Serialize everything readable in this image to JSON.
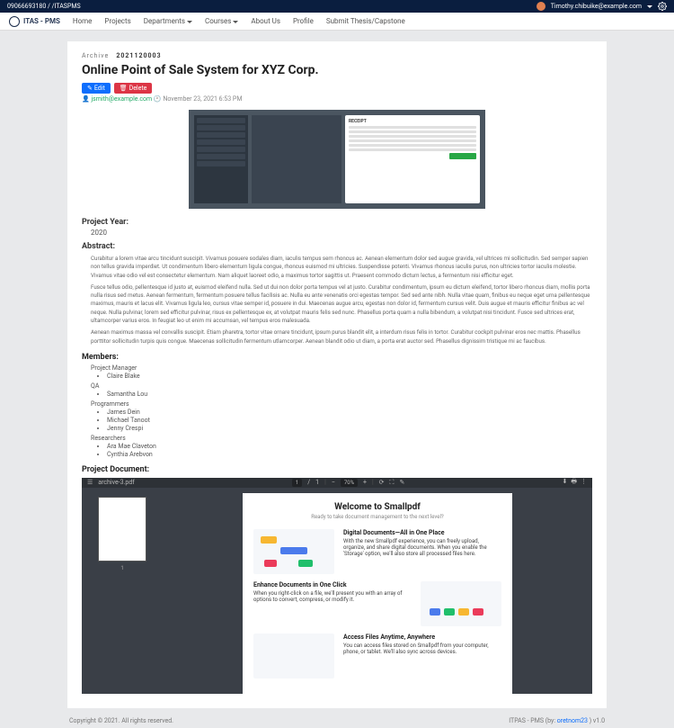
{
  "topstrip": {
    "left": "09066693180 / /ITASPMS",
    "user": "Timothy.chibuike@example.com"
  },
  "nav": {
    "brand": "ITAS - PMS",
    "items": [
      "Home",
      "Projects",
      "Departments",
      "Courses",
      "About Us",
      "Profile",
      "Submit Thesis/Capstone"
    ]
  },
  "crumb": {
    "a": "Archive",
    "b": "2021120003"
  },
  "title": "Online Point of Sale System for XYZ Corp.",
  "btns": {
    "edit": "Edit",
    "del": "Delete"
  },
  "meta": {
    "author": "jsmith@example.com",
    "date": "November 23, 2021 6:53 PM"
  },
  "year": {
    "label": "Project Year:",
    "value": "2020"
  },
  "abs": {
    "label": "Abstract:",
    "p1": "Curabitur a lorem vitae arcu tincidunt suscipit. Vivamus posuere sodales diam, iaculis tempus sem rhoncus ac. Aenean elementum dolor sed augue gravida, vel ultrices mi sollicitudin. Sed semper sapien non tellus gravida imperdiet. Ut condimentum libero elementum ligula congue, rhoncus euismod mi ultricies. Suspendisse potenti. Vivamus rhoncus iaculis purus, non ultricies tortor iaculis molestie. Vivamus vitae odio vel est consectetur elementum. Nam aliquet laoreet odio, a maximus tortor sagittis ut. Praesent commodo dictum lectus, a fermentum nisi efficitur eget.",
    "p2": "Fusce tellus odio, pellentesque id justo at, euismod eleifend nulla. Sed ut dui non dolor porta tempus vel at justo. Curabitur condimentum, ipsum eu dictum eleifend, tortor libero rhoncus diam, mollis porta nulla risus sed metus. Aenean fermentum, fermentum posuere tellus facilisis ac. Nulla eu ante venenatis orci egestas tempor. Sed sed ante nibh. Nulla vitae quam, finibus eu neque eget urna pellentesque maximus, mauris et lacus elit. Vivamus ligula leo, cursus vitae semper id, posuere in dui. Maecenas augue arcu, egestas non dolor id, fermentum cursus velit. Duis augue et mauris efficitur finibus ac vel neque. Nulla pulvinar, lorem sed efficitur pulvinar, risus ex pellentesque ex, at volutpat mauris felis sed nunc. Phasellus porta quam a nulla bibendum, a volutpat nisi tincidunt. Fusce sed ultrices erat, ultamcorper varius eros. In feugiat leo ut enim mi accumsan, vel tempus eros malesuada.",
    "p3": "Aenean maximus massa vel convallis suscipit. Etiam pharetra, tortor vitae ornare tincidunt, ipsum purus blandit elit, a interdum risus felis in tortor. Curabitur cockpit pulvinar eros nec mattis. Phasellus porttitor sollicitudin turpis quis congue. Maecenas sollicitudin fermentum utlamcorper. Aenean blandit odio ut diam, a porta erat auctor sed. Phasellus dignissim tristique mi ac faucibus."
  },
  "mem": {
    "label": "Members:",
    "roles": [
      {
        "role": "Project Manager",
        "list": [
          "Claire Blake"
        ]
      },
      {
        "role": "QA",
        "list": [
          "Samantha Lou"
        ]
      },
      {
        "role": "Programmers",
        "list": [
          "James Dein",
          "Michael Tanoot",
          "Jenny Crespi"
        ]
      },
      {
        "role": "Researchers",
        "list": [
          "Ara Mae Claveton",
          "Cynthia Arebvon"
        ]
      }
    ]
  },
  "doc": {
    "label": "Project Document:"
  },
  "pdf": {
    "file": "archive-3.pdf",
    "page": "1",
    "of": "1",
    "zoom": "70%",
    "thumb_num": "1",
    "h": "Welcome to Smallpdf",
    "sub": "Ready to take document management to the next level?",
    "s1": {
      "t": "Digital Documents—All in One Place",
      "b": "With the new Smallpdf experience, you can freely upload, organize, and share digital documents. When you enable the 'Storage' option, we'll also store all processed files here.",
      "lk": "Storage"
    },
    "s2": {
      "t": "Enhance Documents in One Click",
      "b": "When you right-click on a file, we'll present you with an array of options to convert, compress, or modify it."
    },
    "s3": {
      "t": "Access Files Anytime, Anywhere",
      "b": "You can access files stored on Smallpdf from your computer, phone, or tablet. We'll also sync across devices."
    }
  },
  "footer": {
    "left": "Copyright © 2021. All rights reserved.",
    "right_a": "ITPAS - PMS",
    "right_b": "(by:",
    "right_link": "oretnom23",
    "right_c": ") v1.0"
  }
}
